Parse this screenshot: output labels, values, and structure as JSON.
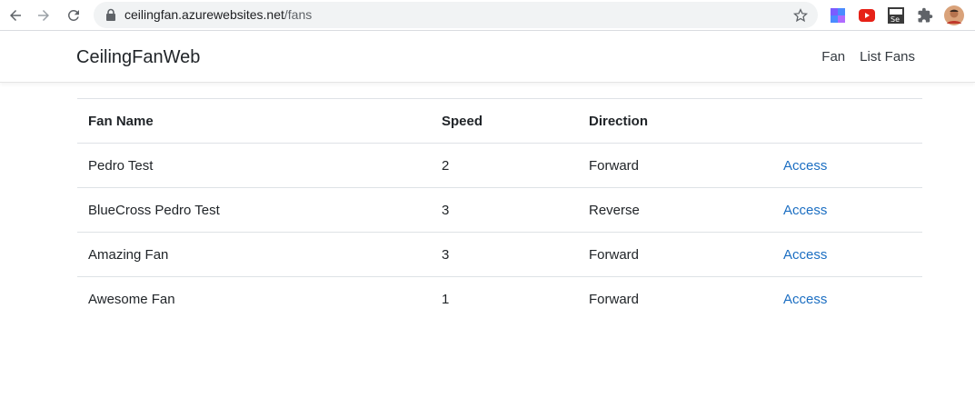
{
  "browser": {
    "url_host": "ceilingfan.azurewebsites.net",
    "url_path": "/fans"
  },
  "navbar": {
    "brand": "CeilingFanWeb",
    "links": [
      "Fan",
      "List Fans"
    ]
  },
  "table": {
    "headers": [
      "Fan Name",
      "Speed",
      "Direction",
      ""
    ],
    "rows": [
      {
        "name": "Pedro Test",
        "speed": "2",
        "direction": "Forward",
        "action": "Access"
      },
      {
        "name": "BlueCross Pedro Test",
        "speed": "3",
        "direction": "Reverse",
        "action": "Access"
      },
      {
        "name": "Amazing Fan",
        "speed": "3",
        "direction": "Forward",
        "action": "Access"
      },
      {
        "name": "Awesome Fan",
        "speed": "1",
        "direction": "Forward",
        "action": "Access"
      }
    ]
  },
  "colors": {
    "link": "#1b6ec2",
    "text": "#212529",
    "border": "#dee2e6"
  },
  "icons": [
    "back-arrow-icon",
    "forward-arrow-icon",
    "reload-icon",
    "lock-icon",
    "bookmark-star-icon",
    "extension-icon",
    "youtube-icon",
    "selenium-icon",
    "puzzle-icon",
    "profile-avatar-icon"
  ]
}
